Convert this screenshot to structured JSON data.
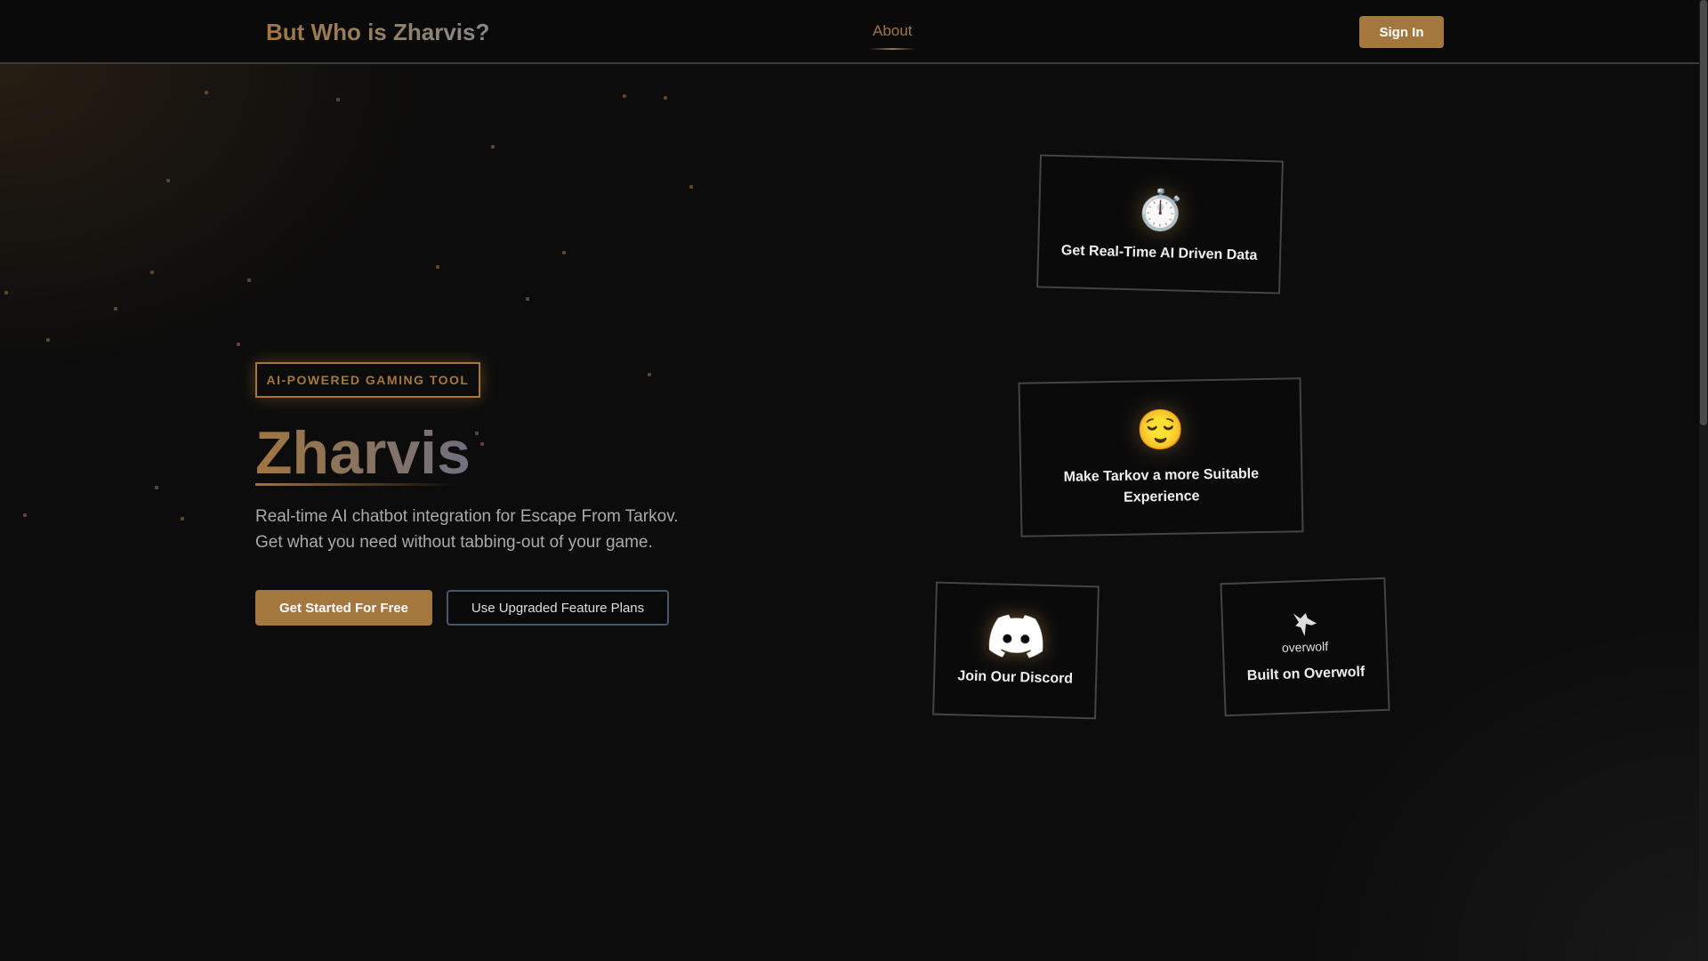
{
  "header": {
    "title": "But Who is Zharvis?",
    "nav_about": "About",
    "sign_in": "Sign In"
  },
  "hero": {
    "badge": "AI-POWERED GAMING TOOL",
    "title": "Zharvis",
    "desc_line1": "Real-time AI chatbot integration for Escape From Tarkov.",
    "desc_line2": "Get what you need without tabbing-out of your game.",
    "cta_primary": "Get Started For Free",
    "cta_secondary": "Use Upgraded Feature Plans"
  },
  "cards": [
    {
      "icon": "stopwatch-icon",
      "glyph": "⏱️",
      "label": "Get Real-Time AI Driven Data"
    },
    {
      "icon": "relieved-face-icon",
      "glyph": "😌",
      "label": "Make Tarkov a more Suitable Experience"
    },
    {
      "icon": "discord-icon",
      "label": "Join Our Discord"
    },
    {
      "icon": "overwolf-icon",
      "logo_text": "overwolf",
      "label": "Built on Overwolf"
    }
  ],
  "colors": {
    "accent": "#a4773e",
    "bg": "#0b0b0b"
  }
}
